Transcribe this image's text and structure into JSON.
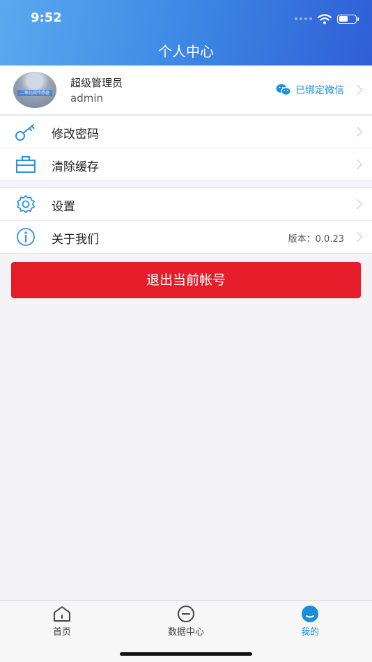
{
  "status": {
    "time": "9:52",
    "battery_level": 0.55
  },
  "header": {
    "title": "个人中心"
  },
  "profile": {
    "name": "超级管理员",
    "username": "admin",
    "avatar_caption": "二氧化碳传感器",
    "wechat_status": "已绑定微信"
  },
  "menu_group_1": [
    {
      "label": "修改密码",
      "icon": "key-icon"
    },
    {
      "label": "清除缓存",
      "icon": "briefcase-icon"
    }
  ],
  "menu_group_2": [
    {
      "label": "设置",
      "icon": "gear-icon"
    },
    {
      "label": "关于我们",
      "icon": "info-icon",
      "value": "版本：0.0.23"
    }
  ],
  "logout_label": "退出当前帐号",
  "tabs": [
    {
      "label": "首页",
      "icon": "home-icon"
    },
    {
      "label": "数据中心",
      "icon": "minus-circle-icon"
    },
    {
      "label": "我的",
      "icon": "user-face-icon",
      "active": true
    }
  ],
  "colors": {
    "primary": "#1a8fd8",
    "danger": "#e51d2a",
    "header_start": "#5ba9ee",
    "header_end": "#2f5fd6"
  }
}
